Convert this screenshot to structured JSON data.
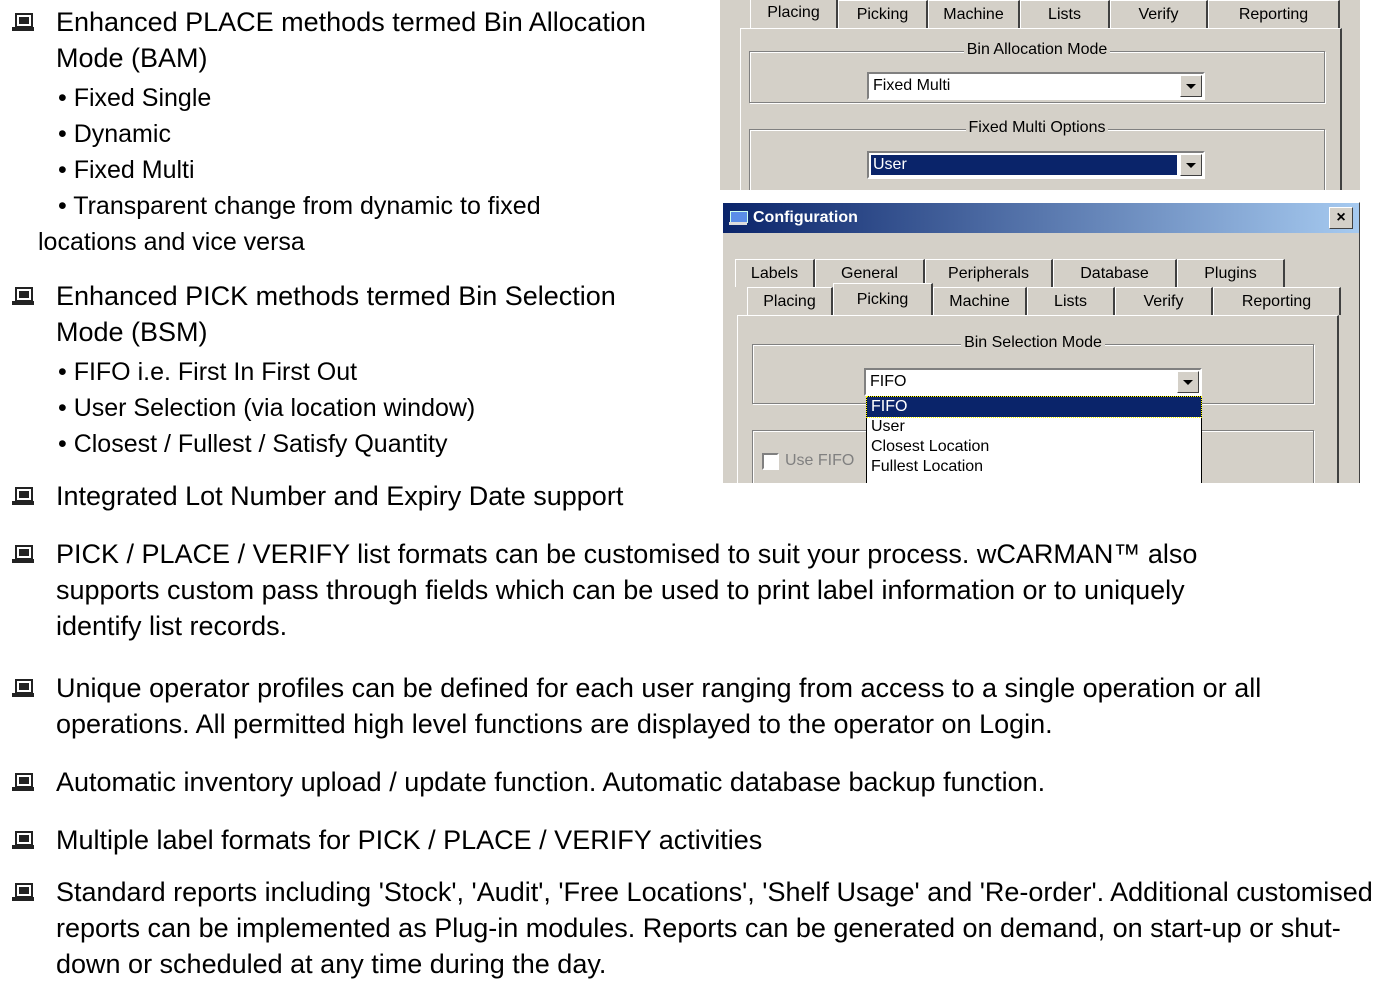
{
  "bullets_top": [
    {
      "text": "Enhanced PLACE methods termed Bin Allocation Mode (BAM)",
      "subs": [
        "• Fixed Single",
        "• Dynamic",
        "• Fixed Multi",
        "• Transparent change from dynamic to fixed",
        "locations and vice versa"
      ]
    },
    {
      "text": "Enhanced PICK methods termed Bin Selection Mode (BSM)",
      "subs": [
        "• FIFO i.e. First In First Out",
        "• User Selection (via location window)",
        "• Closest / Fullest / Satisfy Quantity"
      ]
    },
    {
      "text": "Integrated Lot Number and Expiry Date support"
    }
  ],
  "bullets_bottom": [
    "PICK / PLACE / VERIFY list formats can be customised to suit your process. wCARMAN™ also supports custom pass through fields which can be used to print label information or to uniquely identify list records.",
    "Unique operator profiles can be defined for each user ranging from access to a single operation or all operations. All permitted high level functions are displayed to the operator on Login.",
    "Automatic inventory upload / update function. Automatic database backup function.",
    "Multiple label formats for PICK / PLACE / VERIFY activities",
    "Standard reports including 'Stock', 'Audit', 'Free Locations', 'Shelf Usage' and 'Re-order'. Additional customised reports can be implemented as Plug-in modules. Reports can be generated on demand, on start-up or shut-down or scheduled at any time during the day."
  ],
  "dialog1": {
    "tabs_row2": [
      "Placing",
      "Picking",
      "Machine",
      "Lists",
      "Verify",
      "Reporting"
    ],
    "group1_label": "Bin Allocation Mode",
    "combo1_value": "Fixed Multi",
    "group2_label": "Fixed Multi Options",
    "combo2_value": "User"
  },
  "dialog2": {
    "title": "Configuration",
    "close_glyph": "×",
    "tabs_row1": [
      "Labels",
      "General",
      "Peripherals",
      "Database",
      "Plugins"
    ],
    "tabs_row2": [
      "Placing",
      "Picking",
      "Machine",
      "Lists",
      "Verify",
      "Reporting"
    ],
    "group_label": "Bin Selection Mode",
    "combo_value": "FIFO",
    "options": [
      "FIFO",
      "User",
      "Closest Location",
      "Fullest Location"
    ],
    "checkbox_label": "Use FIFO"
  }
}
